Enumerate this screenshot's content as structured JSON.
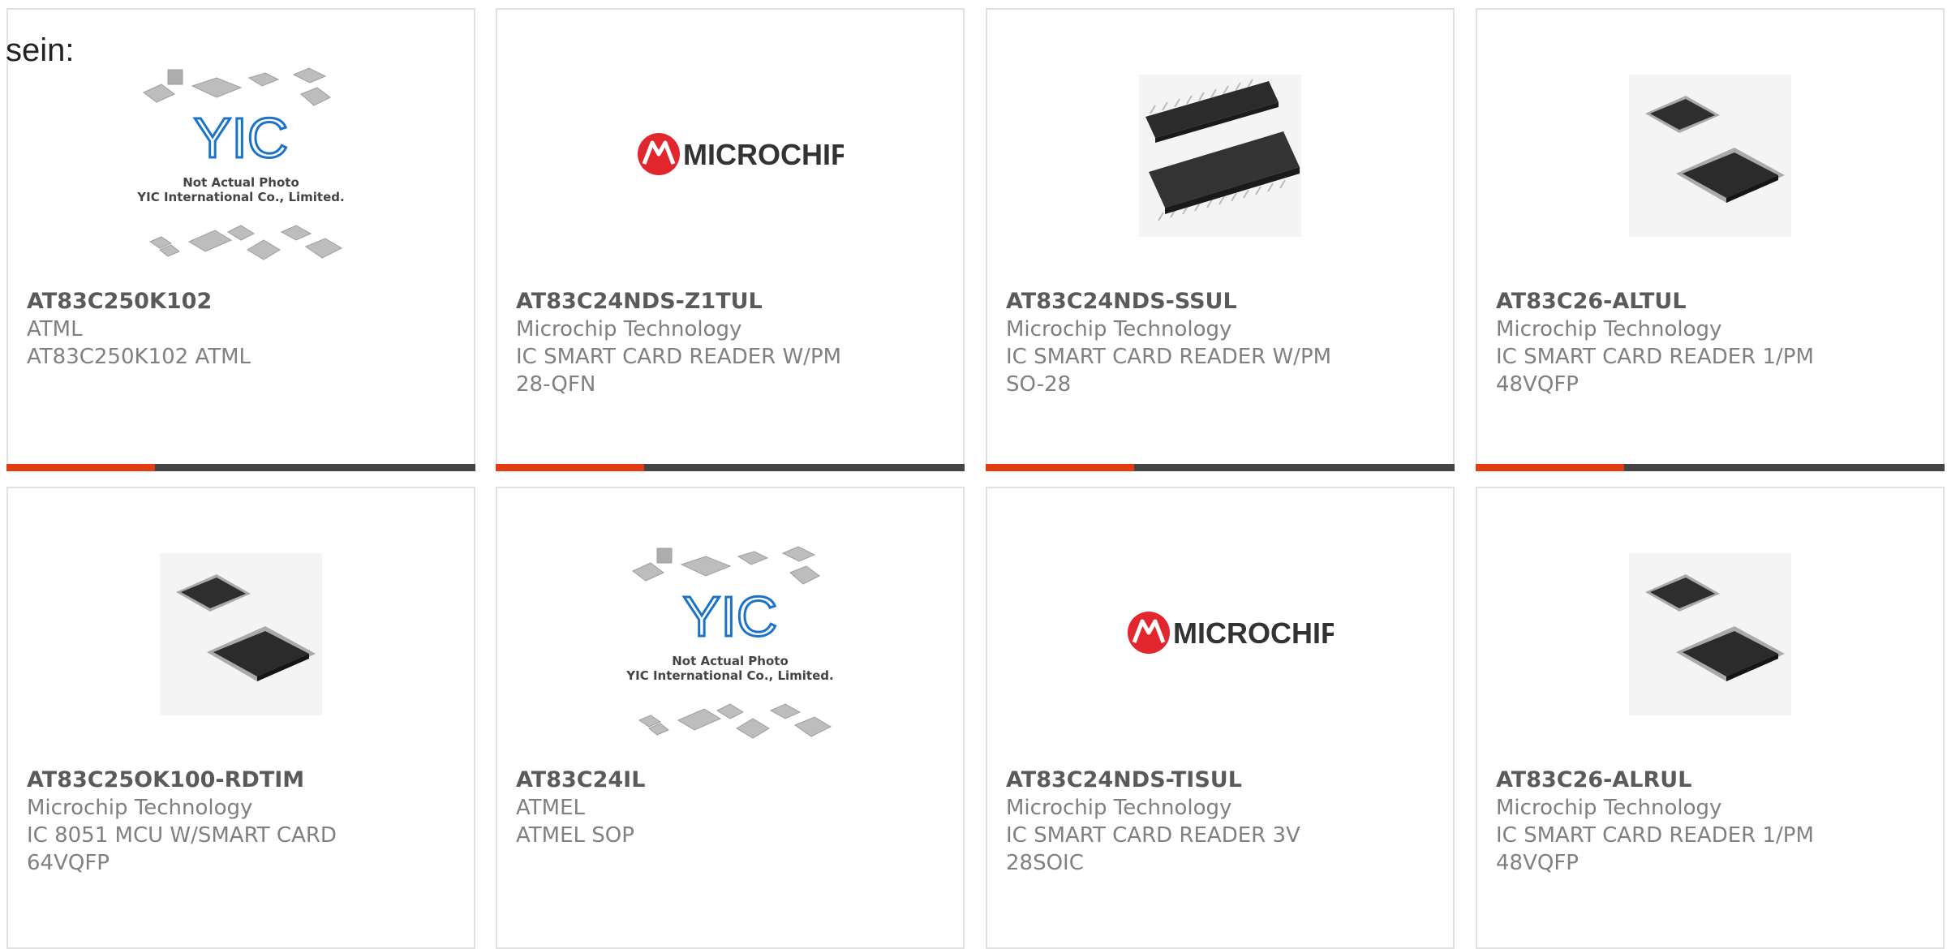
{
  "intro_text": "sein:",
  "products": [
    {
      "part": "AT83C250K102",
      "maker": "ATML",
      "desc": "AT83C250K102 ATML",
      "pkg": "",
      "image": "yic-placeholder",
      "caption_1": "Not Actual Photo",
      "caption_2": "YIC International Co., Limited.",
      "logo_text": "YIC"
    },
    {
      "part": "AT83C24NDS-Z1TUL",
      "maker": "Microchip Technology",
      "desc": "IC SMART CARD READER W/PM",
      "pkg": "28-QFN",
      "image": "microchip-logo",
      "logo_text": "Microchip"
    },
    {
      "part": "AT83C24NDS-SSUL",
      "maker": "Microchip Technology",
      "desc": "IC SMART CARD READER W/PM",
      "pkg": "SO-28",
      "image": "so-chip"
    },
    {
      "part": "AT83C26-ALTUL",
      "maker": "Microchip Technology",
      "desc": "IC SMART CARD READER 1/PM",
      "pkg": "48VQFP",
      "image": "qfp-chip"
    },
    {
      "part": "AT83C25OK100-RDTIM",
      "maker": "Microchip Technology",
      "desc": "IC 8051 MCU W/SMART CARD",
      "pkg": "64VQFP",
      "image": "qfp-chip"
    },
    {
      "part": "AT83C24IL",
      "maker": "ATMEL",
      "desc": "ATMEL SOP",
      "pkg": "",
      "image": "yic-placeholder",
      "caption_1": "Not Actual Photo",
      "caption_2": "YIC International Co., Limited.",
      "logo_text": "YIC"
    },
    {
      "part": "AT83C24NDS-TISUL",
      "maker": "Microchip Technology",
      "desc": "IC SMART CARD READER 3V",
      "pkg": "28SOIC",
      "image": "microchip-logo",
      "logo_text": "Microchip"
    },
    {
      "part": "AT83C26-ALRUL",
      "maker": "Microchip Technology",
      "desc": "IC SMART CARD READER 1/PM",
      "pkg": "48VQFP",
      "image": "qfp-chip"
    }
  ],
  "colors": {
    "accent": "#e23d12",
    "bar": "#444444",
    "border": "#e1e1e1",
    "microchip_red": "#e1262d",
    "yic_blue": "#1a73c7"
  }
}
